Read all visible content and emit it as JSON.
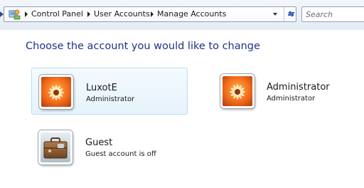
{
  "breadcrumb": {
    "items": [
      "Control Panel",
      "User Accounts",
      "Manage Accounts"
    ]
  },
  "search": {
    "placeholder": "Search"
  },
  "main": {
    "heading": "Choose the account you would like to change",
    "accounts": [
      {
        "name": "LuxotE",
        "type": "Administrator",
        "picture": "flower-icon",
        "selected": true
      },
      {
        "name": "Administrator",
        "type": "Administrator",
        "picture": "flower-icon",
        "selected": false
      },
      {
        "name": "Guest",
        "type": "Guest account is off",
        "picture": "briefcase-icon",
        "selected": false
      }
    ]
  },
  "colors": {
    "heading": "#1e3287",
    "selection_bg": "#e6f3fc",
    "selection_border": "#b9dcf3",
    "flower_orange": "#f26a1b"
  }
}
